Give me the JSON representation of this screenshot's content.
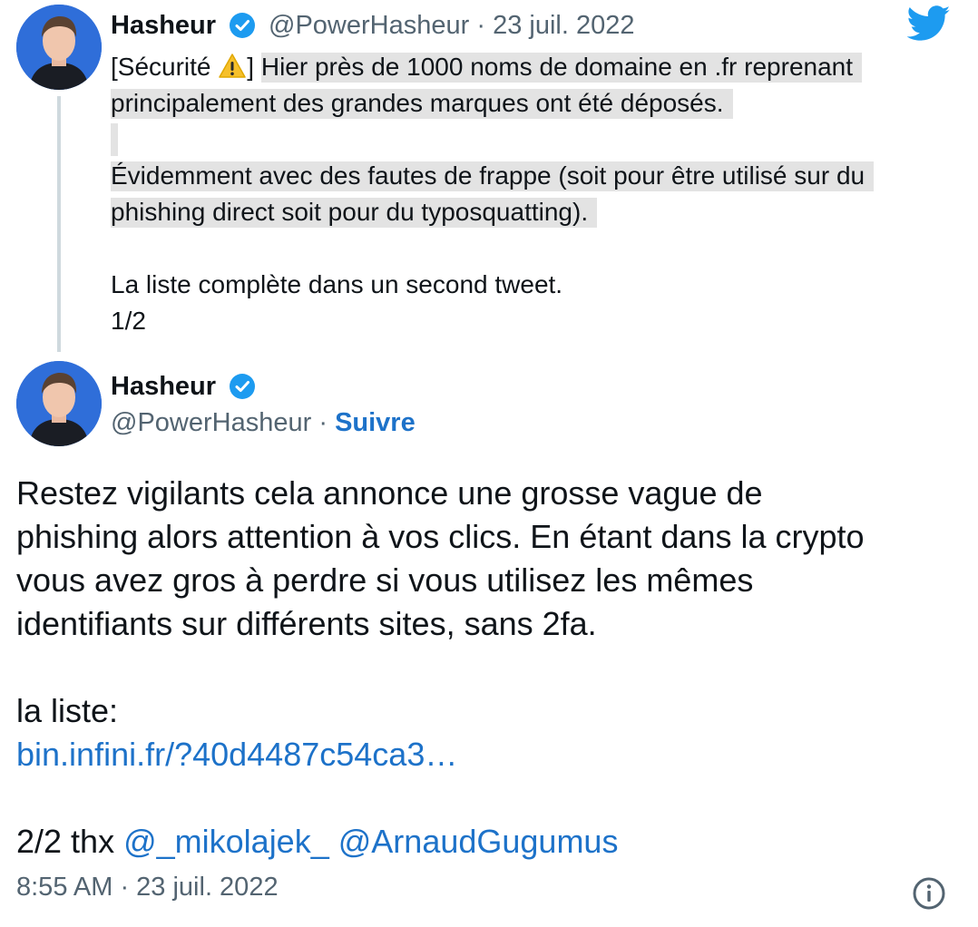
{
  "parent_tweet": {
    "author_name": "Hasheur",
    "handle": "@PowerHasheur",
    "separator": "·",
    "date": "23 juil. 2022",
    "lines": [
      {
        "pre": "[Sécurité ",
        "emoji": "⚠️",
        "post": "] ",
        "hl": "Hier près de 1000 noms de domaine en .fr reprenant"
      },
      {
        "hl": "principalement des grandes marques ont été déposés."
      },
      {
        "hl": "Évidemment avec des fautes de frappe (soit pour être utilisé sur du"
      },
      {
        "hl": "phishing direct soit pour du typosquatting)."
      },
      {
        "text": "La liste complète dans un second tweet."
      },
      {
        "text": "1/2"
      }
    ]
  },
  "main_tweet": {
    "author_name": "Hasheur",
    "handle": "@PowerHasheur",
    "separator": "·",
    "follow_label": "Suivre",
    "body_lines": [
      "Restez vigilants cela annonce une grosse vague de",
      "phishing alors attention à vos clics. En étant dans la crypto",
      "vous avez gros à perdre si vous utilisez les mêmes",
      "identifiants sur différents sites, sans 2fa."
    ],
    "list_label": "la liste:",
    "link_text": "bin.infini.fr/?40d4487c54ca3…",
    "thanks_prefix": "2/2 thx",
    "mentions": [
      "@_mikolajek_",
      "@ArnaudGugumus"
    ],
    "timestamp": "8:55 AM · 23 juil. 2022"
  },
  "icons": {
    "brand": "twitter-bird-icon",
    "verified": "verified-badge-icon",
    "info": "info-icon",
    "warning": "warning-emoji-icon"
  },
  "colors": {
    "link": "#1d72c9",
    "twitter_blue": "#1d9bf0",
    "muted": "#536471",
    "highlight": "#e3e3e3"
  }
}
